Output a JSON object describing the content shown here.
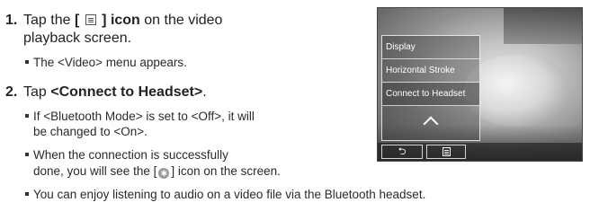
{
  "steps": [
    {
      "number": "1.",
      "text_prefix": "Tap the ",
      "icon_label": "[ ",
      "icon_label_end": " ] icon",
      "text_suffix": " on the video",
      "continuation": "playback screen.",
      "bullets": [
        "The <Video> menu appears."
      ]
    },
    {
      "number": "2.",
      "text_prefix": "Tap ",
      "bold_text": "<Connect to Headset>",
      "text_suffix": ".",
      "bullets": [
        "If <Bluetooth Mode> is set to <Off>, it will",
        "be changed to <On>.",
        "When the connection is successfully",
        "done, you will see the [",
        "] icon on the screen.",
        "You can enjoy listening to audio on a video file via the Bluetooth headset."
      ]
    }
  ],
  "device": {
    "menu_items": [
      "Display",
      "Horizontal Stroke",
      "Connect to Headset"
    ],
    "back_glyph": "⮌"
  }
}
